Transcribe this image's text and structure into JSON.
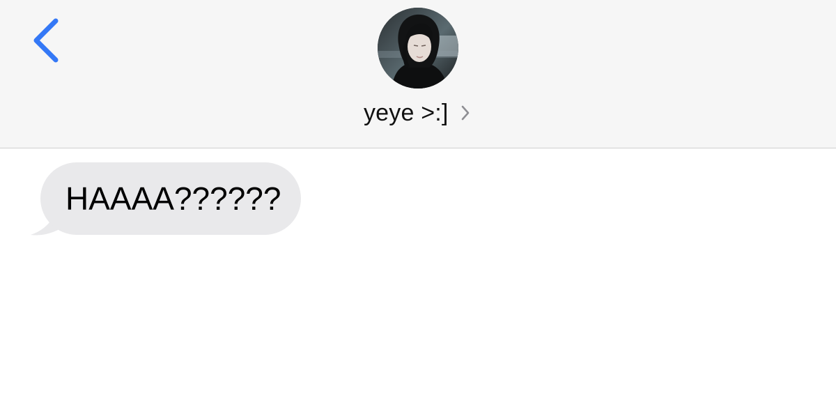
{
  "header": {
    "back_icon": "chevron-left-icon",
    "accent_color": "#3478f6",
    "contact": {
      "name": "yeye >:]",
      "avatar": "contact-avatar-photo",
      "detail_icon": "chevron-right-icon"
    }
  },
  "thread": {
    "messages": [
      {
        "direction": "incoming",
        "text": "HAAAA??????",
        "bubble_color": "#e9e9eb"
      }
    ]
  }
}
